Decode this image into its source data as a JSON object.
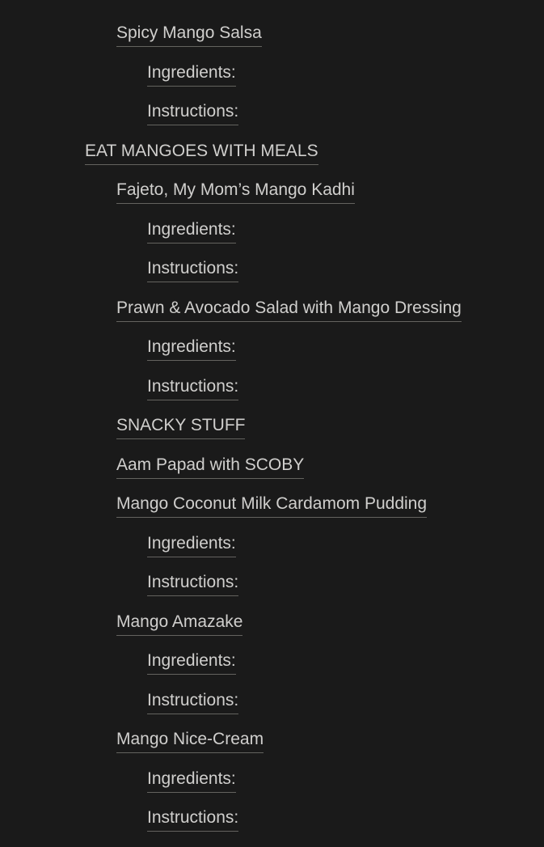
{
  "theme": {
    "background": "#1a1a1a",
    "link_color": "#d0cfcd",
    "underline_color": "#64635f"
  },
  "outline": {
    "items": [
      {
        "label": "Spicy Mango Salsa",
        "level": 2,
        "kind": "recipe-title"
      },
      {
        "label": "Ingredients:",
        "level": 3,
        "kind": "section-link"
      },
      {
        "label": "Instructions:",
        "level": 3,
        "kind": "section-link"
      },
      {
        "label": "EAT MANGOES WITH MEALS",
        "level": 1,
        "kind": "section-heading"
      },
      {
        "label": "Fajeto, My Mom’s Mango Kadhi",
        "level": 2,
        "kind": "recipe-title"
      },
      {
        "label": "Ingredients:",
        "level": 3,
        "kind": "section-link"
      },
      {
        "label": "Instructions:",
        "level": 3,
        "kind": "section-link"
      },
      {
        "label": "Prawn & Avocado Salad with Mango Dressing",
        "level": 2,
        "kind": "recipe-title"
      },
      {
        "label": "Ingredients:",
        "level": 3,
        "kind": "section-link"
      },
      {
        "label": "Instructions:",
        "level": 3,
        "kind": "section-link"
      },
      {
        "label": "SNACKY STUFF",
        "level": 2,
        "kind": "section-heading"
      },
      {
        "label": "Aam Papad with SCOBY",
        "level": 2,
        "kind": "recipe-title"
      },
      {
        "label": "Mango Coconut Milk Cardamom Pudding",
        "level": 2,
        "kind": "recipe-title"
      },
      {
        "label": "Ingredients:",
        "level": 3,
        "kind": "section-link"
      },
      {
        "label": "Instructions:",
        "level": 3,
        "kind": "section-link"
      },
      {
        "label": "Mango Amazake",
        "level": 2,
        "kind": "recipe-title"
      },
      {
        "label": "Ingredients:",
        "level": 3,
        "kind": "section-link"
      },
      {
        "label": "Instructions:",
        "level": 3,
        "kind": "section-link"
      },
      {
        "label": "Mango Nice-Cream",
        "level": 2,
        "kind": "recipe-title"
      },
      {
        "label": "Ingredients:",
        "level": 3,
        "kind": "section-link"
      },
      {
        "label": "Instructions:",
        "level": 3,
        "kind": "section-link"
      }
    ]
  }
}
